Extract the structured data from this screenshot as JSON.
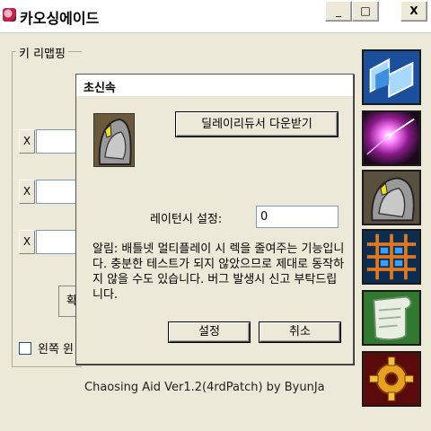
{
  "window": {
    "title": "카오싱에이드",
    "minimize": "_",
    "maximize": "□",
    "close": "X"
  },
  "main": {
    "group_label": "키 리맵핑",
    "x_buttons": [
      "X",
      "X",
      "X"
    ],
    "stub_button": "확",
    "checkbox_label": "왼쪽 윈",
    "credits": "Chaosing Aid Ver1.2(4rdPatch) by ByunJa"
  },
  "side_buttons": [
    {
      "icon": "blue-arrows-icon"
    },
    {
      "icon": "purple-burst-icon"
    },
    {
      "icon": "armored-knight-icon"
    },
    {
      "icon": "orange-net-icon"
    },
    {
      "icon": "scroll-icon"
    },
    {
      "icon": "gear-icon"
    }
  ],
  "dialog": {
    "title": "초신속",
    "download_button": "딜레이리듀서 다운받기",
    "latency_label": "레이턴시 설정:",
    "latency_value": "0",
    "notice": "알림: 배틀넷 멀티플레이 시 렉을 줄여주는 기능입니다. 충분한 테스트가 되지 않았으므로 제대로 동작하지 않을 수도 있습니다. 버그 발생시 신고 부탁드립니다.",
    "ok_button": "설정",
    "cancel_button": "취소"
  }
}
